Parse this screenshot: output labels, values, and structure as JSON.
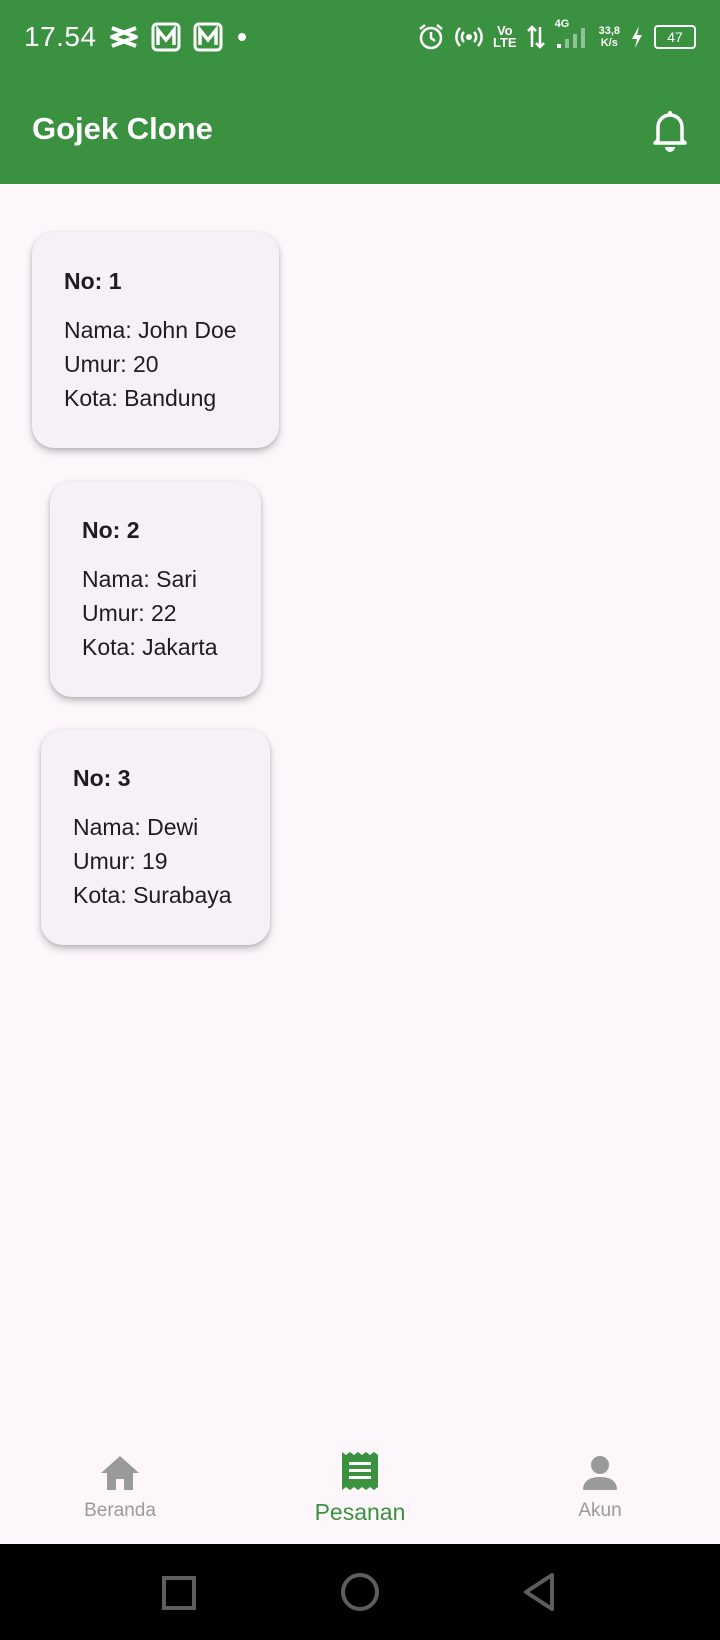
{
  "status_bar": {
    "time": "17.54",
    "net_4g": "4G",
    "speed_value": "33,8",
    "speed_unit": "K/s",
    "volte_top": "Vo",
    "volte_bottom": "LTE",
    "battery": "47"
  },
  "app_bar": {
    "title": "Gojek Clone"
  },
  "cards": [
    {
      "no": "No: 1",
      "nama": "Nama: John Doe",
      "umur": "Umur: 20",
      "kota": "Kota: Bandung"
    },
    {
      "no": "No: 2",
      "nama": "Nama: Sari",
      "umur": "Umur: 22",
      "kota": "Kota: Jakarta"
    },
    {
      "no": "No: 3",
      "nama": "Nama: Dewi",
      "umur": "Umur: 19",
      "kota": "Kota: Surabaya"
    }
  ],
  "bottom_nav": {
    "items": [
      {
        "label": "Beranda",
        "icon": "home-icon"
      },
      {
        "label": "Pesanan",
        "icon": "receipt-icon",
        "active": true
      },
      {
        "label": "Akun",
        "icon": "person-icon"
      }
    ]
  },
  "colors": {
    "primary": "#3a913f",
    "background": "#fdf7fc",
    "card": "#f5f1f6",
    "inactive": "#9a9a9a"
  }
}
